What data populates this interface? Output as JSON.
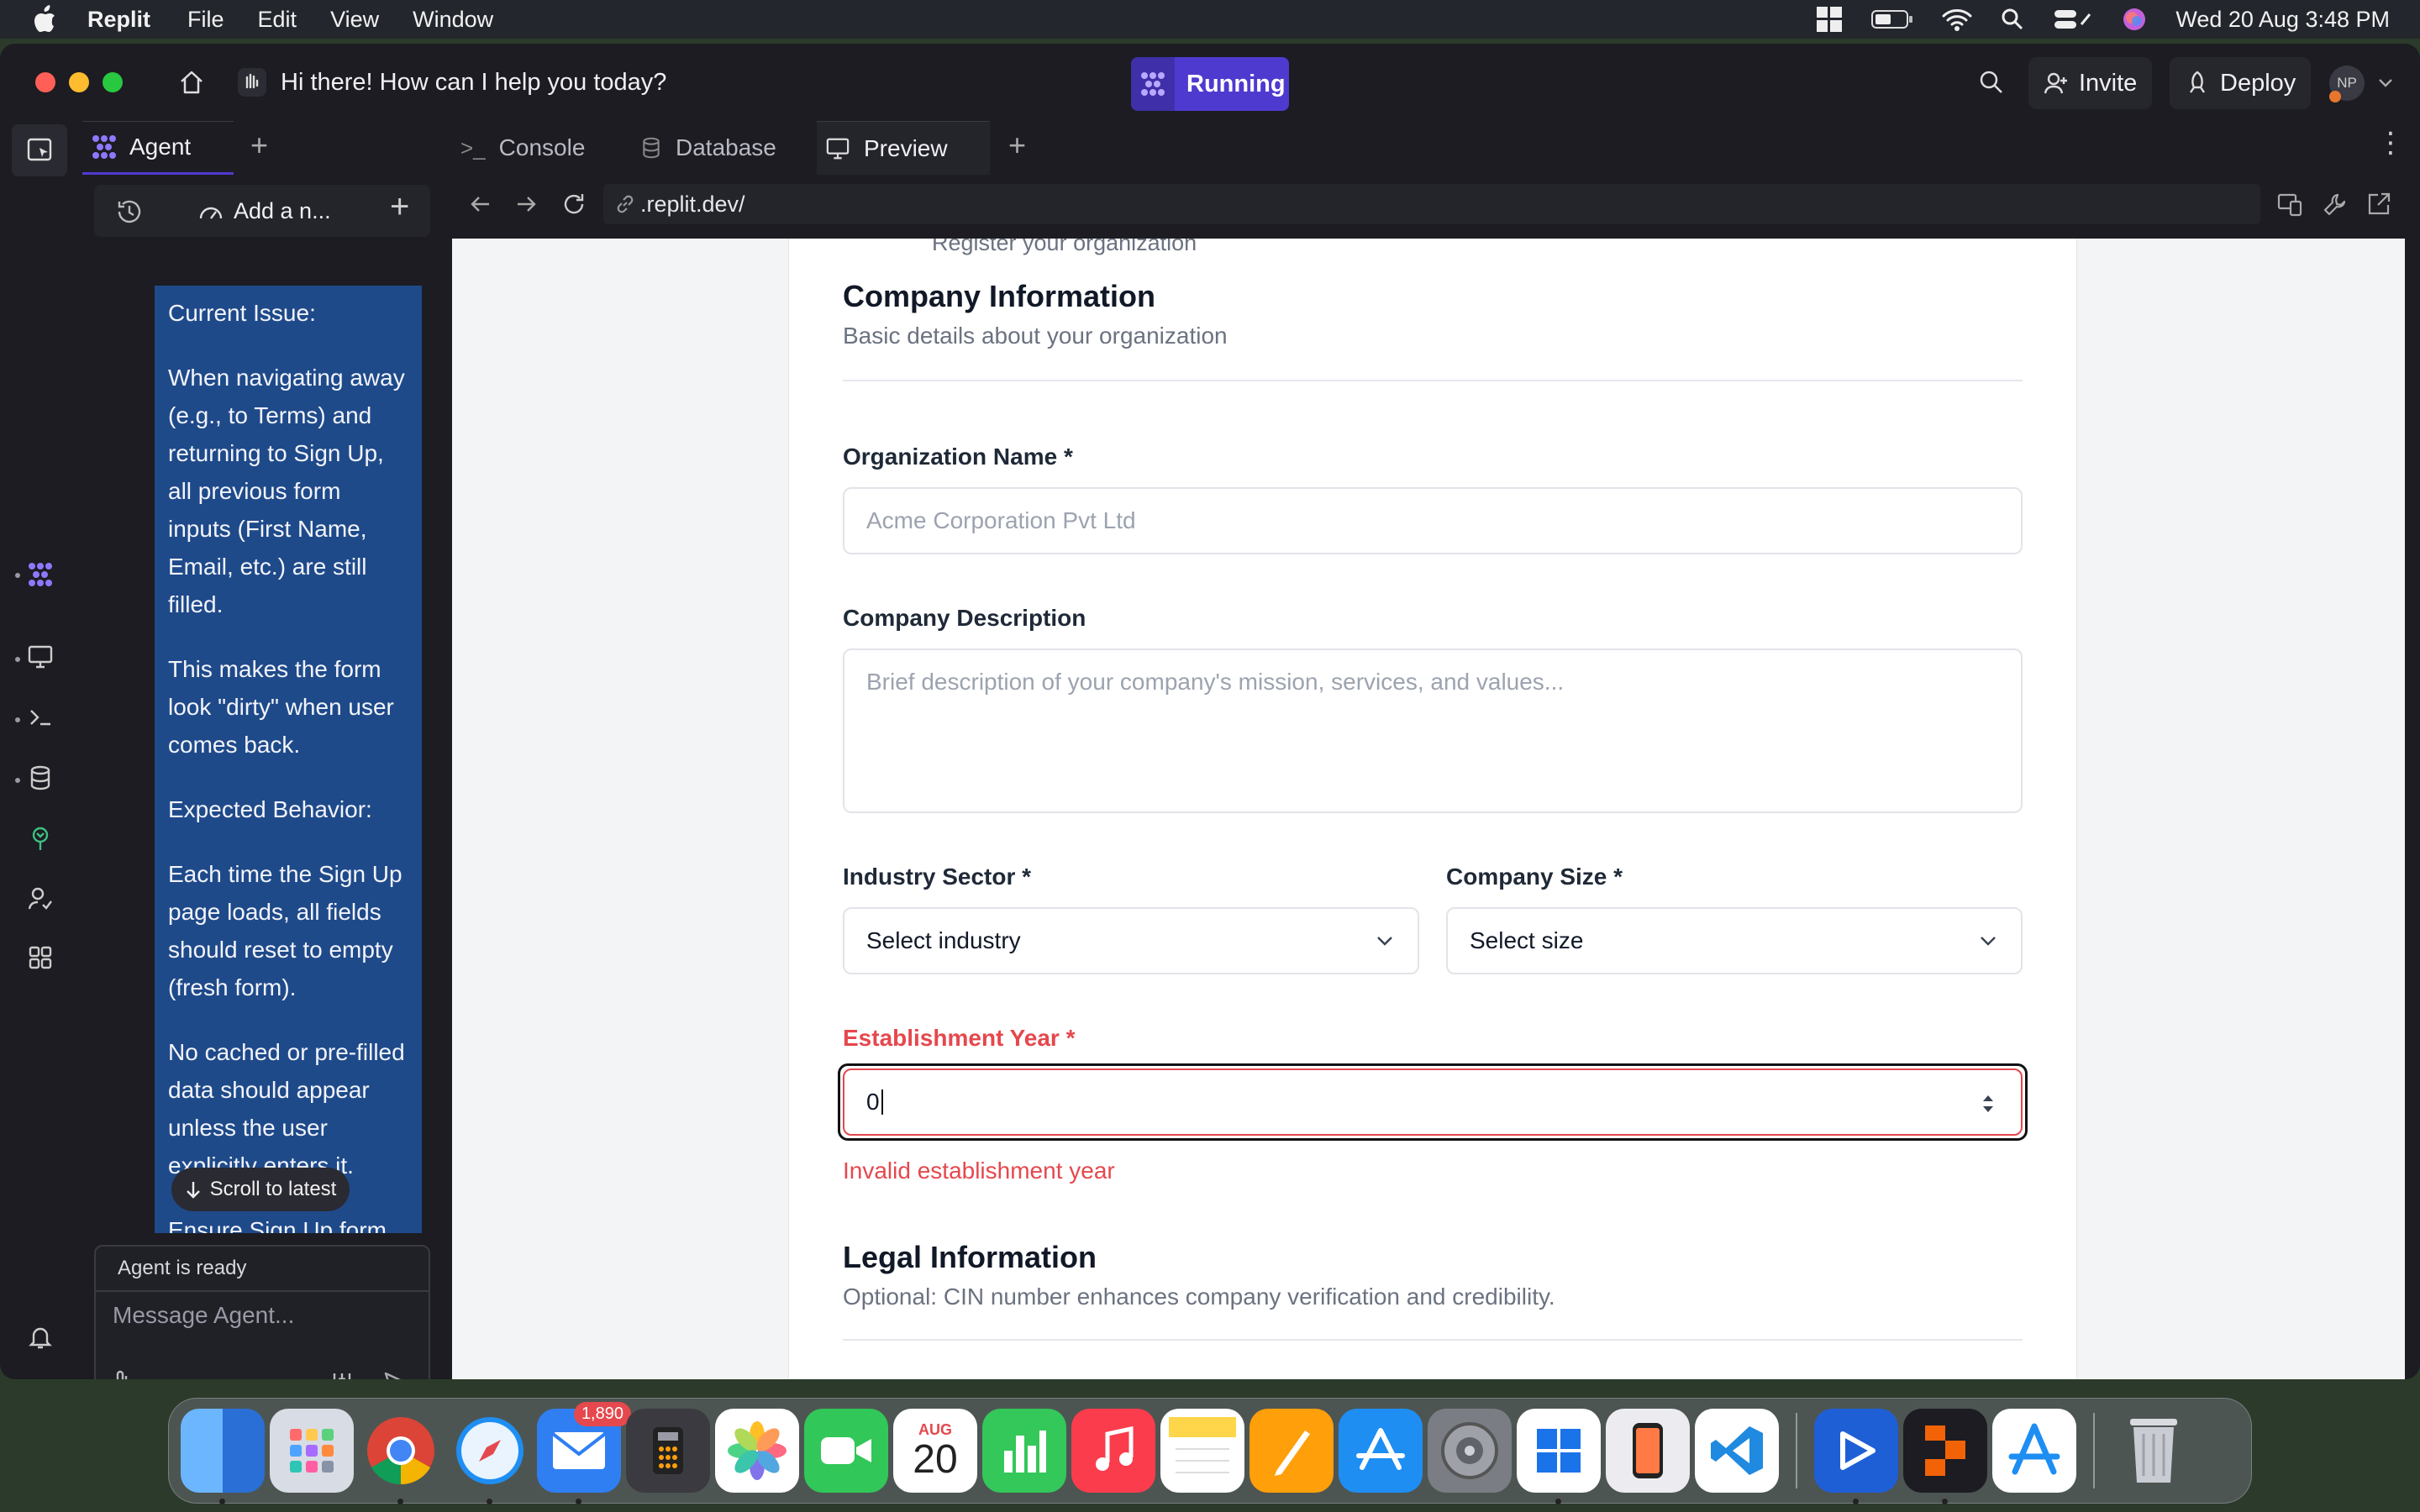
{
  "menubar": {
    "app": "Replit",
    "items": [
      "File",
      "Edit",
      "View",
      "Window"
    ],
    "clock": "Wed 20 Aug  3:48 PM"
  },
  "titlebar": {
    "prompt": "Hi there! How can I help you today?",
    "status": "Running",
    "invite": "Invite",
    "deploy": "Deploy",
    "avatar": "NP"
  },
  "agent": {
    "tab": "Agent",
    "thread": "Add a n...",
    "messages": [
      "Current Issue:",
      "When navigating away (e.g., to Terms) and returning to Sign Up, all previous form inputs (First Name, Email, etc.) are still filled.",
      "This makes the form look \"dirty\" when user comes back.",
      "Expected Behavior:",
      "Each time the Sign Up page loads, all fields should reset to empty (fresh form).",
      "No cached or pre-filled data should appear unless the user explicitly enters it.",
      "Ensure Sign Up form"
    ],
    "scroll_latest": "Scroll to latest",
    "ready": "Agent is ready",
    "placeholder": "Message Agent..."
  },
  "tabs": {
    "console": "Console",
    "database": "Database",
    "preview": "Preview"
  },
  "url": ".replit.dev/",
  "form": {
    "clipped_line": "Register your organization",
    "section1_title": "Company Information",
    "section1_sub": "Basic details about your organization",
    "org_name_label": "Organization Name *",
    "org_name_placeholder": "Acme Corporation Pvt Ltd",
    "desc_label": "Company Description",
    "desc_placeholder": "Brief description of your company's mission, services, and values...",
    "industry_label": "Industry Sector *",
    "industry_value": "Select industry",
    "size_label": "Company Size *",
    "size_value": "Select size",
    "year_label": "Establishment Year *",
    "year_value": "0",
    "year_error": "Invalid establishment year",
    "section2_title": "Legal Information",
    "section2_sub": "Optional: CIN number enhances company verification and credibility."
  },
  "dock": {
    "mail_badge": "1,890",
    "calendar_month": "AUG",
    "calendar_day": "20"
  },
  "colors": {
    "accent": "#4f3ad0",
    "chat_bubble": "#1f4a8a",
    "error": "#e5484d"
  }
}
